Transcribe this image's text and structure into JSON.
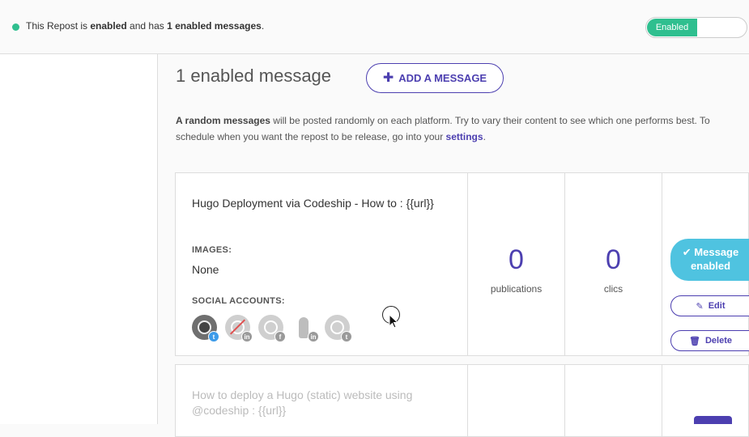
{
  "status": {
    "prefix": "This Repost is ",
    "state": "enabled",
    "middle": " and has ",
    "count": "1 enabled messages",
    "suffix": ".",
    "dot_color": "#2fbf8f"
  },
  "toggle": {
    "label": "Enabled",
    "state": "on"
  },
  "main": {
    "heading": "1 enabled message",
    "add_button": "ADD A MESSAGE",
    "description": {
      "bold": "A random messages",
      "text": " will be posted randomly on each platform. Try to vary their content to see which one performs best. To schedule when you want the repost to be release, go into your ",
      "link": "settings",
      "end": "."
    }
  },
  "messages": [
    {
      "text": "Hugo Deployment via Codeship - How to : {{url}}",
      "images_label": "IMAGES:",
      "images_value": "None",
      "social_label": "SOCIAL ACCOUNTS:",
      "accounts": [
        {
          "icon": "twitter-profile-avatar",
          "network": "twitter",
          "badge": "t"
        },
        {
          "icon": "linkedin-disabled-avatar",
          "network": "linkedin",
          "badge": "in"
        },
        {
          "icon": "facebook-avatar",
          "network": "facebook",
          "badge": "f"
        },
        {
          "icon": "linkedin-thumb-avatar",
          "network": "linkedin",
          "badge": "in"
        },
        {
          "icon": "twitter-avatar",
          "network": "twitter",
          "badge": "t"
        }
      ],
      "publications": "0",
      "publications_label": "publications",
      "clics": "0",
      "clics_label": "clics",
      "enabled_label": "Message enabled",
      "edit_label": "Edit",
      "delete_label": "Delete"
    },
    {
      "text": "How to deploy a Hugo (static) website using @codeship : {{url}}"
    }
  ],
  "colors": {
    "accent": "#4c3fb0",
    "enabled_green": "#2fbf8f",
    "enabled_blue": "#4fc3e0"
  }
}
